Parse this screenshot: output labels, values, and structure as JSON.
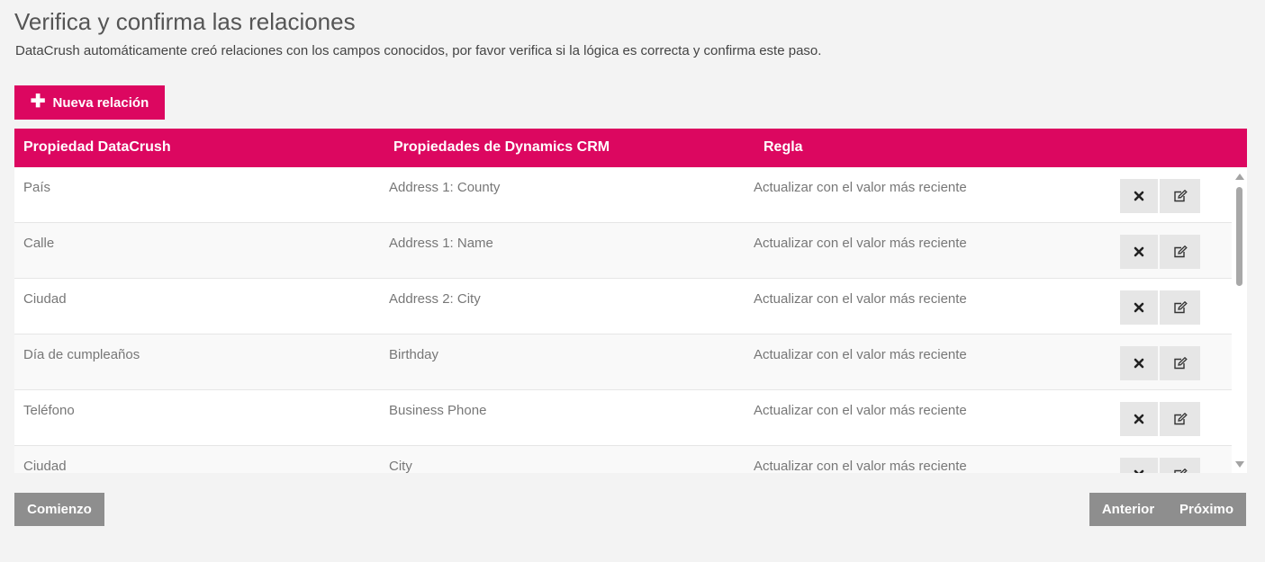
{
  "header": {
    "title": "Verifica y confirma las relaciones",
    "subtitle": "DataCrush automáticamente creó relaciones con los campos conocidos, por favor verifica si la lógica es correcta y confirma este paso."
  },
  "toolbar": {
    "new_relation_icon": "plus-icon",
    "new_relation_label": "Nueva relación"
  },
  "table": {
    "headers": [
      "Propiedad DataCrush",
      "Propiedades de Dynamics CRM",
      "Regla"
    ],
    "rows": [
      {
        "datacrush": "País",
        "crm": "Address 1: County",
        "rule": "Actualizar con el valor más reciente"
      },
      {
        "datacrush": "Calle",
        "crm": "Address 1: Name",
        "rule": "Actualizar con el valor más reciente"
      },
      {
        "datacrush": "Ciudad",
        "crm": "Address 2: City",
        "rule": "Actualizar con el valor más reciente"
      },
      {
        "datacrush": "Día de cumpleaños",
        "crm": "Birthday",
        "rule": "Actualizar con el valor más reciente"
      },
      {
        "datacrush": "Teléfono",
        "crm": "Business Phone",
        "rule": "Actualizar con el valor más reciente"
      },
      {
        "datacrush": "Ciudad",
        "crm": "City",
        "rule": "Actualizar con el valor más reciente"
      }
    ],
    "row_actions": {
      "delete_icon": "close-icon",
      "edit_icon": "edit-icon"
    }
  },
  "footer": {
    "start_label": "Comienzo",
    "prev_label": "Anterior",
    "next_label": "Próximo"
  },
  "colors": {
    "accent": "#dc0760",
    "footer_button": "#8e8e8e",
    "background": "#f3f3f3"
  }
}
